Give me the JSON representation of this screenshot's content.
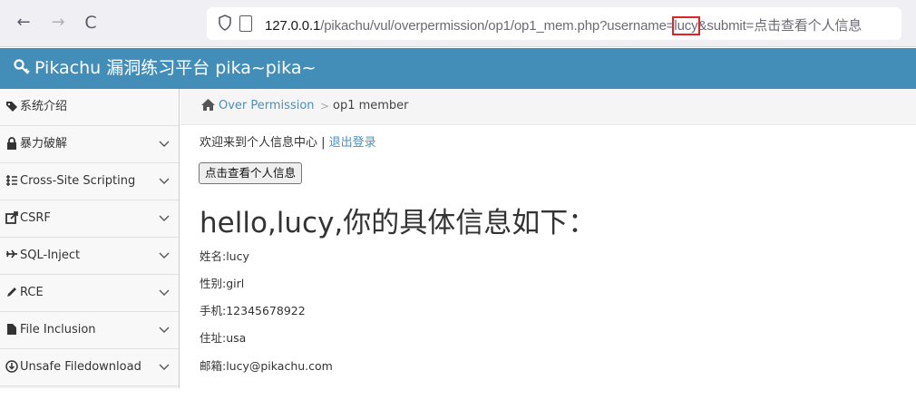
{
  "browser": {
    "back_glyph": "←",
    "forward_glyph": "→",
    "reload_glyph": "C",
    "url_host": "127.0.0.1",
    "url_path": "/pikachu/vul/overpermission/op1/op1_mem.php?username=",
    "url_param_value": "lucy",
    "url_tail": "&submit=点击查看个人信息"
  },
  "header": {
    "title": "Pikachu 漏洞练习平台 pika~pika~"
  },
  "sidebar": {
    "items": [
      {
        "label": "系统介绍",
        "icon": "tag-icon",
        "has_chevron": false
      },
      {
        "label": "暴力破解",
        "icon": "lock-icon",
        "has_chevron": true
      },
      {
        "label": "Cross-Site Scripting",
        "icon": "list-icon",
        "has_chevron": true
      },
      {
        "label": "CSRF",
        "icon": "share-icon",
        "has_chevron": true
      },
      {
        "label": "SQL-Inject",
        "icon": "plane-icon",
        "has_chevron": true
      },
      {
        "label": "RCE",
        "icon": "pencil-icon",
        "has_chevron": true
      },
      {
        "label": "File Inclusion",
        "icon": "file-icon",
        "has_chevron": true
      },
      {
        "label": "Unsafe Filedownload",
        "icon": "download-circle-icon",
        "has_chevron": true
      }
    ]
  },
  "breadcrumb": {
    "parent": "Over Permission",
    "separator": ">",
    "current": "op1 member"
  },
  "content": {
    "welcome_text": "欢迎来到个人信息中心 | ",
    "logout_label": "退出登录",
    "view_button_label": "点击查看个人信息",
    "heading": "hello,lucy,你的具体信息如下：",
    "fields": [
      "姓名:lucy",
      "性别:girl",
      "手机:12345678922",
      "住址:usa",
      "邮箱:lucy@pikachu.com"
    ]
  },
  "colors": {
    "header_bg": "#438eb9",
    "link": "#4c8fbd",
    "highlight_box": "#e02424"
  }
}
